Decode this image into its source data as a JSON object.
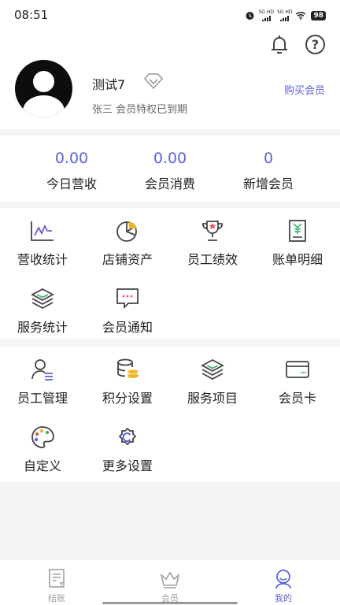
{
  "status_bar": {
    "time": "08:51",
    "net1": "5G HD",
    "net2": "5G HD",
    "battery": "98"
  },
  "profile": {
    "name": "测试7",
    "status": "张三 会员特权已到期",
    "buy_label": "购买会员"
  },
  "stats": [
    {
      "value": "0.00",
      "label": "今日营收"
    },
    {
      "value": "0.00",
      "label": "会员消费"
    },
    {
      "value": "0",
      "label": "新增会员"
    }
  ],
  "section1": [
    {
      "label": "营收统计",
      "icon": "line-chart-icon"
    },
    {
      "label": "店铺资产",
      "icon": "pie-chart-icon"
    },
    {
      "label": "员工绩效",
      "icon": "trophy-icon"
    },
    {
      "label": "账单明细",
      "icon": "bill-icon"
    },
    {
      "label": "服务统计",
      "icon": "layers-icon"
    },
    {
      "label": "会员通知",
      "icon": "message-icon"
    }
  ],
  "section2": [
    {
      "label": "员工管理",
      "icon": "staff-icon"
    },
    {
      "label": "积分设置",
      "icon": "coins-icon"
    },
    {
      "label": "服务项目",
      "icon": "layers-icon"
    },
    {
      "label": "会员卡",
      "icon": "card-icon"
    },
    {
      "label": "自定义",
      "icon": "palette-icon"
    },
    {
      "label": "更多设置",
      "icon": "gear-icon"
    }
  ],
  "tabs": [
    {
      "label": "结账",
      "icon": "receipt-icon",
      "active": false
    },
    {
      "label": "会员",
      "icon": "crown-icon",
      "active": false
    },
    {
      "label": "我的",
      "icon": "person-icon",
      "active": true
    }
  ],
  "colors": {
    "accent": "#5b63d8",
    "icon_green": "#3bb36a",
    "icon_red": "#e8554f",
    "icon_yellow": "#f0b429"
  }
}
